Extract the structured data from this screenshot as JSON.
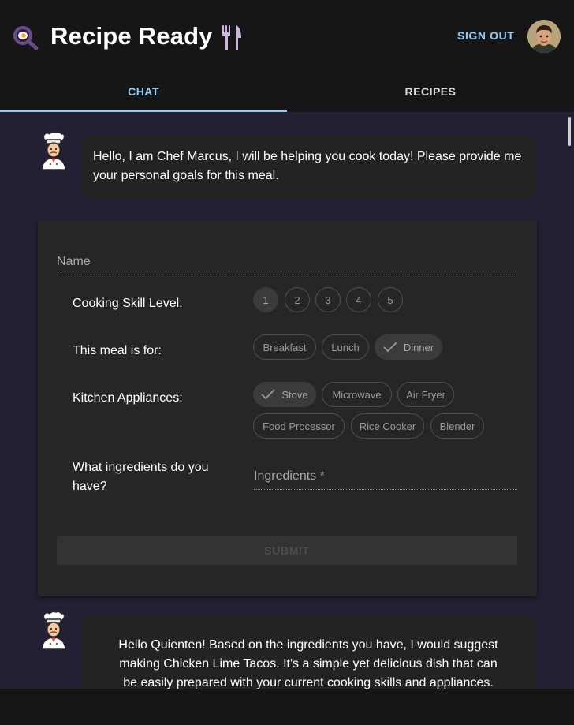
{
  "header": {
    "title": "Recipe Ready",
    "logo_icon": "magnifier-egg-icon",
    "decor_icon": "fork-knife-icon",
    "sign_out_label": "SIGN OUT",
    "avatar": "user-avatar"
  },
  "tabs": [
    {
      "label": "CHAT",
      "active": true
    },
    {
      "label": "RECIPES",
      "active": false
    }
  ],
  "messages": [
    {
      "sender_icon": "chef-icon",
      "text": "Hello, I am Chef Marcus, I will be helping you cook today! Please provide me your personal goals for this meal."
    },
    {
      "sender_icon": "chef-icon",
      "text": "Hello Quienten! Based on the ingredients you have, I would suggest making Chicken Lime Tacos. It's a simple yet delicious dish that can be easily prepared with your current cooking skills and appliances."
    }
  ],
  "form": {
    "name_placeholder": "Name",
    "skill_label": "Cooking Skill Level:",
    "skill_levels": [
      "1",
      "2",
      "3",
      "4",
      "5"
    ],
    "skill_selected": "1",
    "meal_label": "This meal is for:",
    "meal_options": [
      "Breakfast",
      "Lunch",
      "Dinner"
    ],
    "meal_selected": "Dinner",
    "appliances_label": "Kitchen Appliances:",
    "appliance_options": [
      "Stove",
      "Microwave",
      "Air Fryer",
      "Food Processor",
      "Rice Cooker",
      "Blender"
    ],
    "appliances_selected": [
      "Stove"
    ],
    "ingredients_label": "What ingredients do you have?",
    "ingredients_placeholder": "Ingredients *",
    "submit_label": "SUBMIT"
  },
  "colors": {
    "accent": "#90caf9",
    "background": "#232033",
    "header": "#161616",
    "card": "#262626"
  }
}
